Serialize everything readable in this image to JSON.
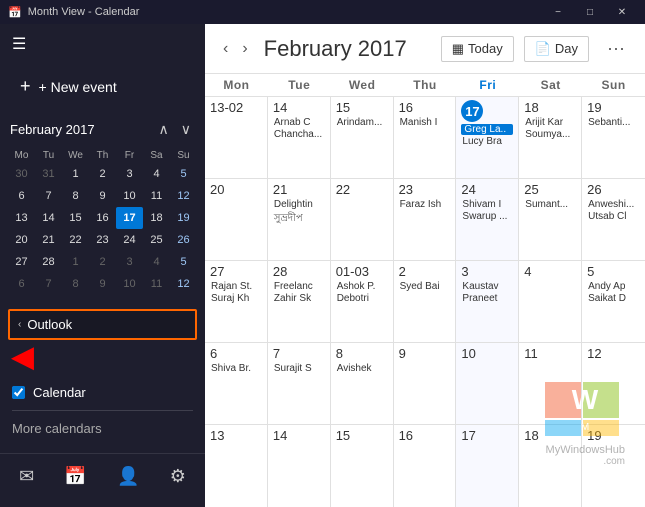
{
  "titleBar": {
    "title": "Month View - Calendar",
    "minBtn": "−",
    "maxBtn": "□",
    "closeBtn": "✕"
  },
  "sidebar": {
    "newEventLabel": "+ New event",
    "miniCal": {
      "title": "February 2017",
      "navUp": "∧",
      "navDown": "∨",
      "dayHeaders": [
        "Mo",
        "Tu",
        "We",
        "Th",
        "Fr",
        "Sa",
        "Su"
      ],
      "weeks": [
        [
          {
            "d": "30",
            "o": true
          },
          {
            "d": "31",
            "o": true
          },
          {
            "d": "1"
          },
          {
            "d": "2"
          },
          {
            "d": "3"
          },
          {
            "d": "4"
          },
          {
            "d": "5",
            "w": true
          }
        ],
        [
          {
            "d": "6"
          },
          {
            "d": "7"
          },
          {
            "d": "8"
          },
          {
            "d": "9"
          },
          {
            "d": "10"
          },
          {
            "d": "11"
          },
          {
            "d": "12",
            "w": true
          }
        ],
        [
          {
            "d": "13"
          },
          {
            "d": "14"
          },
          {
            "d": "15"
          },
          {
            "d": "16"
          },
          {
            "d": "17",
            "t": true
          },
          {
            "d": "18"
          },
          {
            "d": "19",
            "w": true
          }
        ],
        [
          {
            "d": "20"
          },
          {
            "d": "21"
          },
          {
            "d": "22"
          },
          {
            "d": "23"
          },
          {
            "d": "24"
          },
          {
            "d": "25"
          },
          {
            "d": "26",
            "w": true
          }
        ],
        [
          {
            "d": "27"
          },
          {
            "d": "28"
          },
          {
            "d": "1",
            "o": true
          },
          {
            "d": "2",
            "o": true
          },
          {
            "d": "3",
            "o": true
          },
          {
            "d": "4",
            "o": true
          },
          {
            "d": "5",
            "o": true,
            "w": true
          }
        ],
        [
          {
            "d": "6",
            "o": true
          },
          {
            "d": "7",
            "o": true
          },
          {
            "d": "8",
            "o": true
          },
          {
            "d": "9",
            "o": true
          },
          {
            "d": "10",
            "o": true
          },
          {
            "d": "11",
            "o": true
          },
          {
            "d": "12",
            "o": true,
            "w": true
          }
        ]
      ]
    },
    "outlookLabel": "Outlook",
    "calendarCheck": "Calendar",
    "moreCalendars": "More calendars"
  },
  "mainCal": {
    "title": "February 2017",
    "todayBtn": "Today",
    "dayBtn": "Day",
    "calendarIcon": "▦",
    "dayHeaders": [
      "Mon",
      "Tue",
      "Wed",
      "Thu",
      "Fri",
      "Sat",
      "Sun"
    ],
    "weeks": [
      {
        "cells": [
          {
            "date": "13-02",
            "events": []
          },
          {
            "date": "14",
            "events": [
              "Arnab C",
              "Chancha..."
            ]
          },
          {
            "date": "15",
            "events": [
              "Arindam..."
            ]
          },
          {
            "date": "16",
            "events": [
              "Manish I"
            ]
          },
          {
            "date": "17",
            "today": true,
            "events": [
              "Greg La..",
              "Lucy Bra"
            ]
          },
          {
            "date": "18",
            "events": [
              "Arijit Kar",
              "Soumya..."
            ]
          },
          {
            "date": "19",
            "events": [
              "Sebanti..."
            ]
          }
        ]
      },
      {
        "cells": [
          {
            "date": "20",
            "events": []
          },
          {
            "date": "21",
            "events": [
              "Delightin",
              "সুভ্রদীপ"
            ]
          },
          {
            "date": "22",
            "events": []
          },
          {
            "date": "23",
            "events": [
              "Faraz Ish"
            ]
          },
          {
            "date": "24",
            "events": [
              "Shivam I",
              "Swarup ..."
            ]
          },
          {
            "date": "25",
            "events": [
              "Sumant..."
            ]
          },
          {
            "date": "26",
            "events": [
              "Anweshi...",
              "Utsab Cl"
            ]
          }
        ]
      },
      {
        "cells": [
          {
            "date": "27",
            "events": [
              "Rajan St.",
              "Suraj Kh"
            ]
          },
          {
            "date": "28",
            "events": [
              "Freelanc",
              "Zahir Sk"
            ]
          },
          {
            "date": "01-03",
            "events": [
              "Ashok P.",
              "Debotri"
            ]
          },
          {
            "date": "2",
            "events": [
              "Syed Bai"
            ]
          },
          {
            "date": "3",
            "events": [
              "Kaustav",
              "Praneet"
            ]
          },
          {
            "date": "4",
            "events": []
          },
          {
            "date": "5",
            "events": [
              "Andy Ap",
              "Saikat D"
            ]
          }
        ]
      },
      {
        "cells": [
          {
            "date": "6",
            "events": [
              "Shiva Br."
            ]
          },
          {
            "date": "7",
            "events": [
              "Surajit S"
            ]
          },
          {
            "date": "8",
            "events": [
              "Avishek"
            ]
          },
          {
            "date": "9",
            "events": []
          },
          {
            "date": "10",
            "events": []
          },
          {
            "date": "11",
            "events": []
          },
          {
            "date": "12",
            "events": []
          }
        ]
      },
      {
        "cells": [
          {
            "date": "13",
            "events": []
          },
          {
            "date": "14",
            "events": []
          },
          {
            "date": "15",
            "events": []
          },
          {
            "date": "16",
            "events": []
          },
          {
            "date": "17",
            "events": []
          },
          {
            "date": "18",
            "events": []
          },
          {
            "date": "19",
            "events": []
          }
        ]
      }
    ]
  }
}
